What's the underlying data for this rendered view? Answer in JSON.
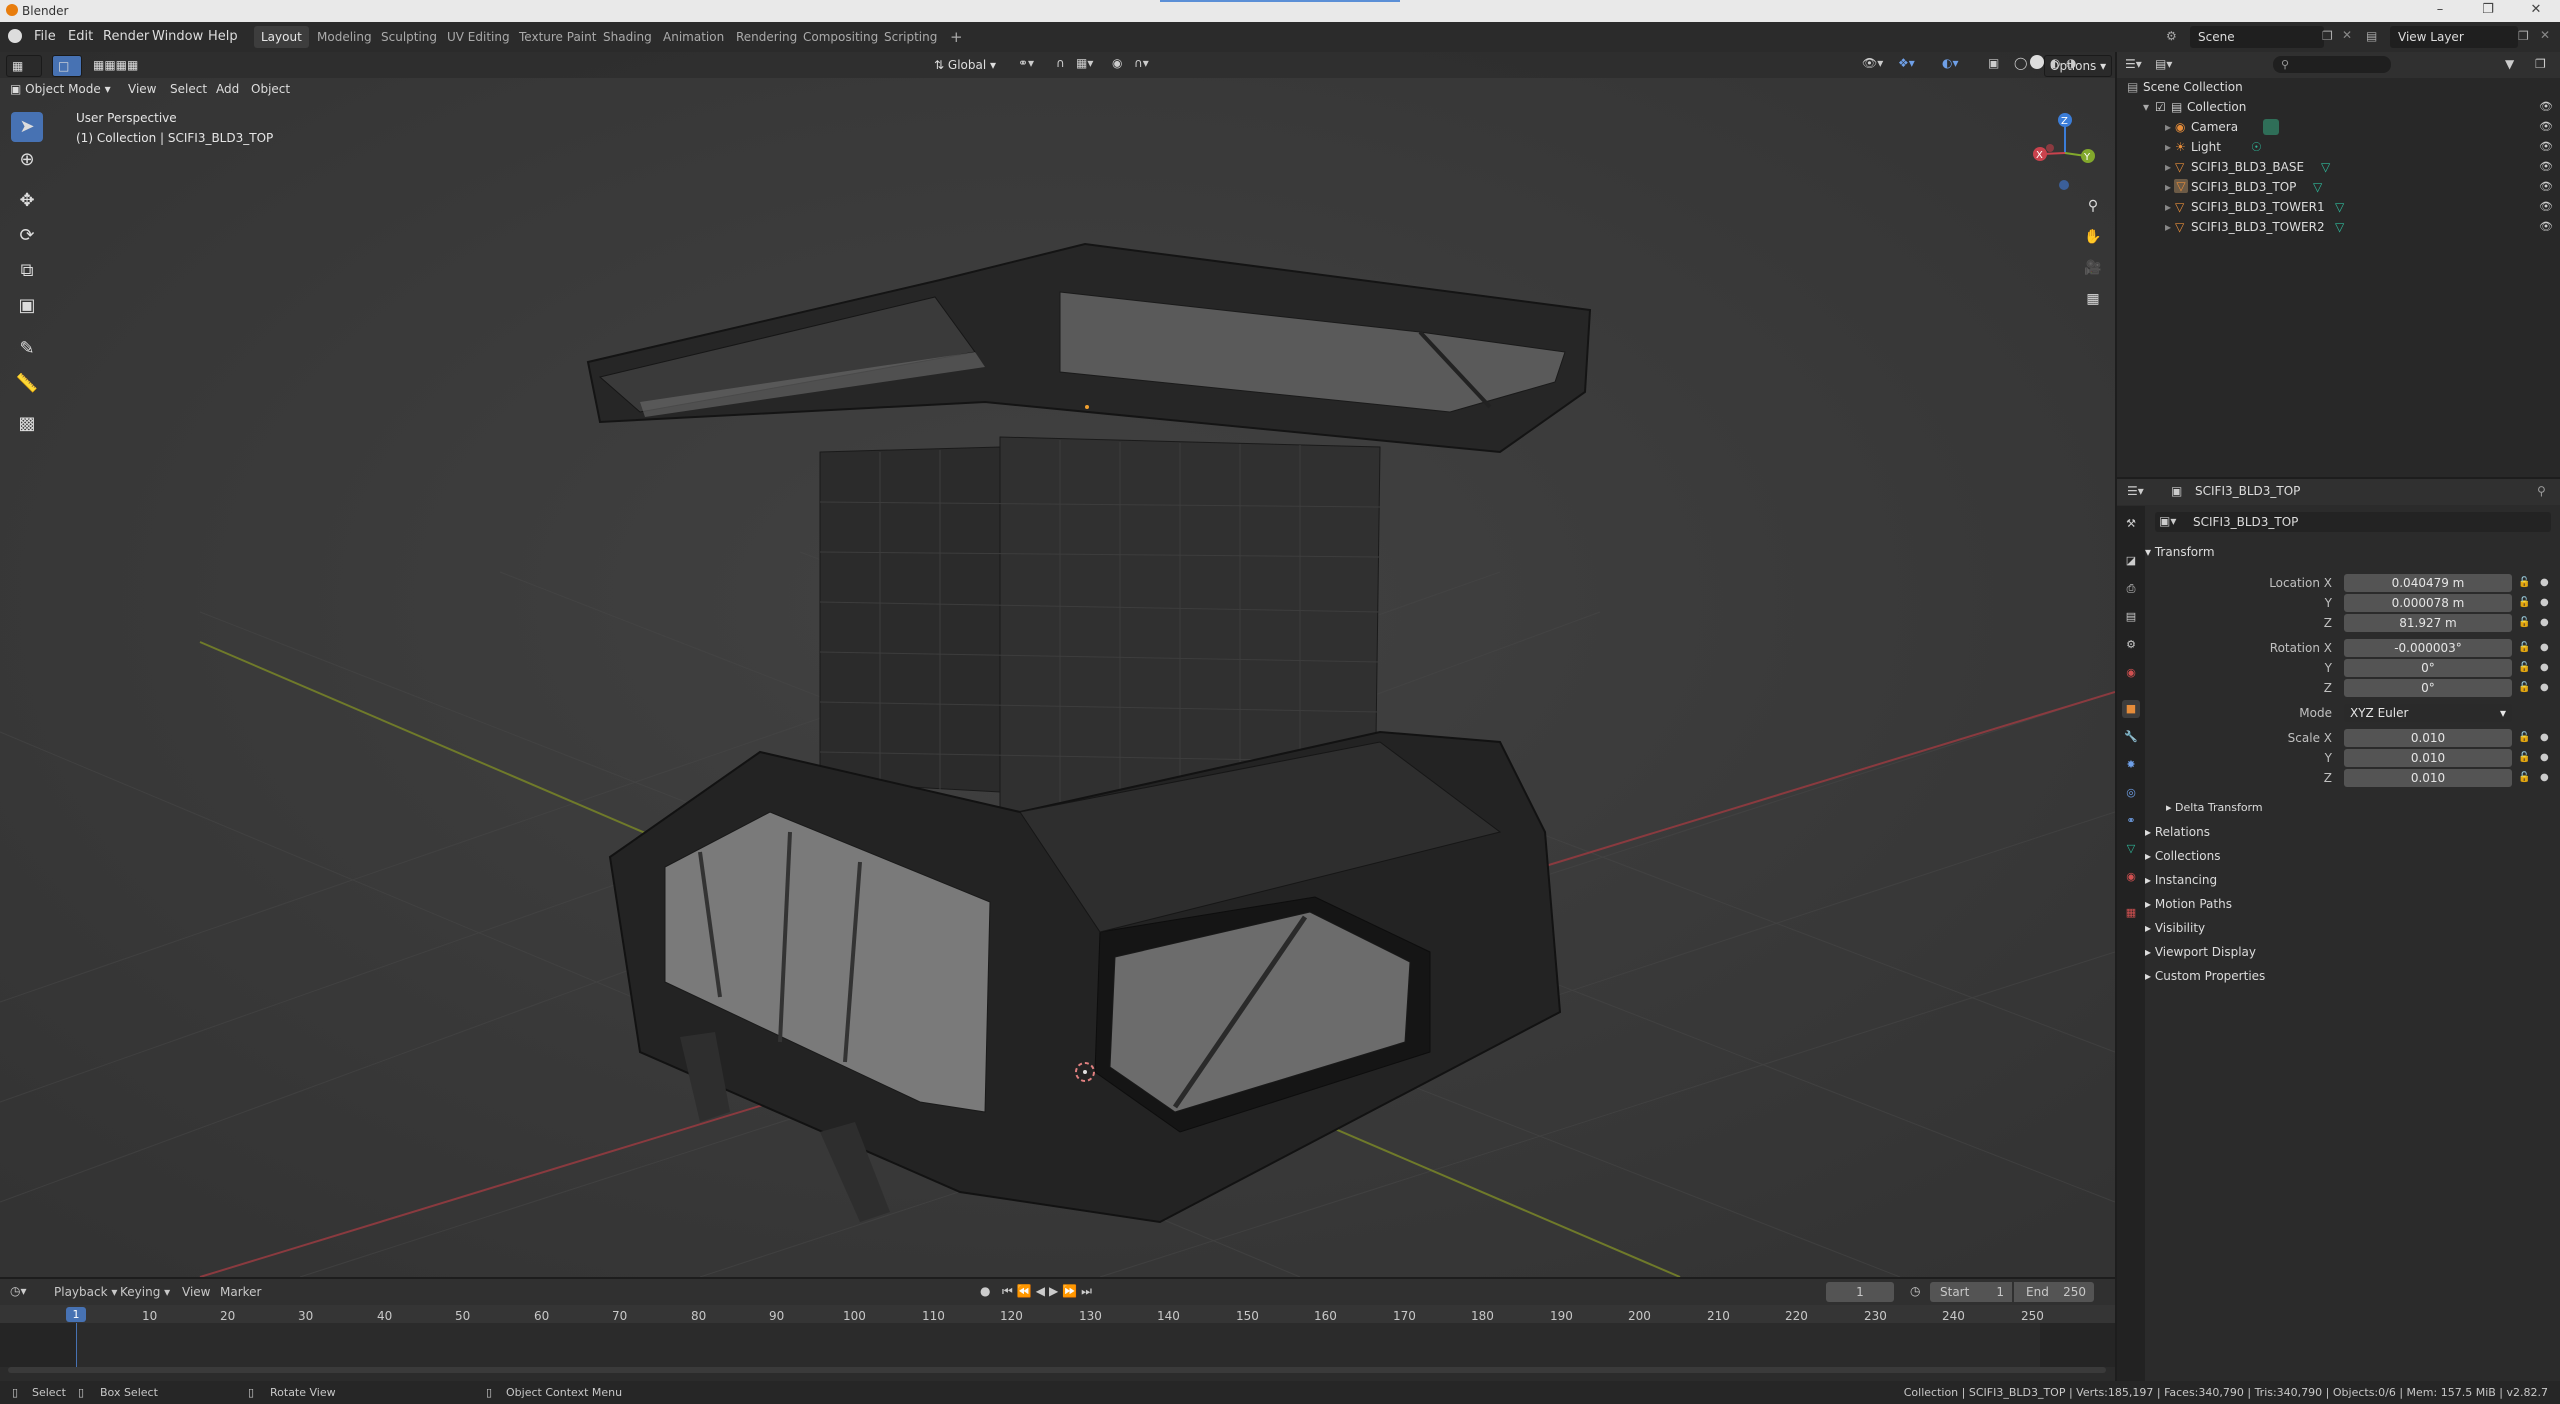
{
  "window": {
    "title": "Blender"
  },
  "menu": {
    "items": [
      "File",
      "Edit",
      "Render",
      "Window",
      "Help"
    ],
    "workspaces": [
      "Layout",
      "Modeling",
      "Sculpting",
      "UV Editing",
      "Texture Paint",
      "Shading",
      "Animation",
      "Rendering",
      "Compositing",
      "Scripting"
    ],
    "active_workspace": "Layout",
    "add_tab": "+",
    "scene": "Scene",
    "view_layer": "View Layer"
  },
  "viewport": {
    "mode": "Object Mode",
    "menus": [
      "View",
      "Select",
      "Add",
      "Object"
    ],
    "orientation": "Global",
    "options": "Options",
    "perspective": "User Perspective",
    "collection_info": "(1) Collection | SCIFI3_BLD3_TOP",
    "gizmo": {
      "x": "X",
      "y": "Y",
      "z": "Z"
    }
  },
  "outliner": {
    "root": "Scene Collection",
    "collection": "Collection",
    "items": [
      {
        "name": "Camera",
        "icon": "camera-icon"
      },
      {
        "name": "Light",
        "icon": "light-icon"
      },
      {
        "name": "SCIFI3_BLD3_BASE",
        "icon": "mesh-icon"
      },
      {
        "name": "SCIFI3_BLD3_TOP",
        "icon": "mesh-icon"
      },
      {
        "name": "SCIFI3_BLD3_TOWER1",
        "icon": "mesh-icon"
      },
      {
        "name": "SCIFI3_BLD3_TOWER2",
        "icon": "mesh-icon"
      }
    ]
  },
  "properties": {
    "object_name": "SCIFI3_BLD3_TOP",
    "object_field": "SCIFI3_BLD3_TOP",
    "transform_title": "Transform",
    "location_label": "Location X",
    "location": [
      "0.040479 m",
      "0.000078 m",
      "81.927 m"
    ],
    "rotation_label": "Rotation X",
    "rotation": [
      "-0.000003°",
      "0°",
      "0°"
    ],
    "mode_label": "Mode",
    "mode_value": "XYZ Euler",
    "scale_label": "Scale X",
    "scale": [
      "0.010",
      "0.010",
      "0.010"
    ],
    "axis_y": "Y",
    "axis_z": "Z",
    "delta_transform": "Delta Transform",
    "panels": [
      "Relations",
      "Collections",
      "Instancing",
      "Motion Paths",
      "Visibility",
      "Viewport Display",
      "Custom Properties"
    ]
  },
  "timeline": {
    "menus": [
      "Playback",
      "Keying",
      "View",
      "Marker"
    ],
    "current_frame": "1",
    "start_label": "Start",
    "start": "1",
    "end_label": "End",
    "end": "250",
    "ticks": [
      "1",
      "10",
      "20",
      "30",
      "40",
      "50",
      "60",
      "70",
      "80",
      "90",
      "100",
      "110",
      "120",
      "130",
      "140",
      "150",
      "160",
      "170",
      "180",
      "190",
      "200",
      "210",
      "220",
      "230",
      "240",
      "250"
    ]
  },
  "statusbar": {
    "select": "Select",
    "box_select": "Box Select",
    "rotate_view": "Rotate View",
    "context_menu": "Object Context Menu",
    "stats": "Collection | SCIFI3_BLD3_TOP | Verts:185,197 | Faces:340,790 | Tris:340,790 | Objects:0/6 | Mem: 157.5 MiB | v2.82.7"
  },
  "colors": {
    "accent": "#4772b3",
    "selection_bg": "#334d80",
    "x_axis": "#c9424d",
    "y_axis": "#82a82c",
    "z_axis": "#3b7dd8",
    "mesh_icon": "#2fb89a",
    "object_icon": "#e58c3a"
  }
}
